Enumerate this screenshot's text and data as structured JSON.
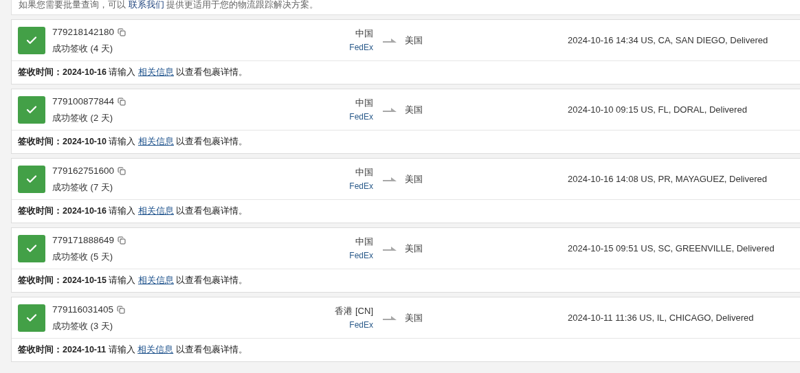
{
  "notice": {
    "before": "如果您需要批量查询，可以",
    "link": "联系我们",
    "after": "提供更适用于您的物流跟踪解决方案。"
  },
  "shipments": [
    {
      "delivered": true,
      "number": "779218142180",
      "summary": "成功签收 (4 天)",
      "origin": "中国",
      "carrier": "FedEx",
      "destination": "美国",
      "latest": "2024-10-16 14:34",
      "event": "US, CA, SAN DIEGO, Delivered",
      "label": "签收时间：",
      "date": "2024-10-16",
      "prompt": "请输入",
      "link": "相关信息",
      "suffix": "以查看包裹详情。"
    },
    {
      "delivered": true,
      "number": "779100877844",
      "summary": "成功签收 (2 天)",
      "origin": "中国",
      "carrier": "FedEx",
      "destination": "美国",
      "latest": "2024-10-10 09:15",
      "event": "US, FL, DORAL, Delivered",
      "label": "签收时间：",
      "date": "2024-10-10",
      "prompt": "请输入",
      "link": "相关信息",
      "suffix": "以查看包裹详情。"
    },
    {
      "delivered": true,
      "number": "779162751600",
      "summary": "成功签收 (7 天)",
      "origin": "中国",
      "carrier": "FedEx",
      "destination": "美国",
      "latest": "2024-10-16 14:08",
      "event": "US, PR, MAYAGUEZ, Delivered",
      "label": "签收时间：",
      "date": "2024-10-16",
      "prompt": "请输入",
      "link": "相关信息",
      "suffix": "以查看包裹详情。"
    },
    {
      "delivered": true,
      "number": "779171888649",
      "summary": "成功签收 (5 天)",
      "origin": "中国",
      "carrier": "FedEx",
      "destination": "美国",
      "latest": "2024-10-15 09:51",
      "event": "US, SC, GREENVILLE, Delivered",
      "label": "签收时间：",
      "date": "2024-10-15",
      "prompt": "请输入",
      "link": "相关信息",
      "suffix": "以查看包裹详情。"
    },
    {
      "delivered": true,
      "number": "779116031405",
      "summary": "成功签收 (3 天)",
      "origin": "香港 [CN]",
      "carrier": "FedEx",
      "destination": "美国",
      "latest": "2024-10-11 11:36",
      "event": "US, IL, CHICAGO, Delivered",
      "label": "签收时间：",
      "date": "2024-10-11",
      "prompt": "请输入",
      "link": "相关信息",
      "suffix": "以查看包裹详情。"
    }
  ]
}
